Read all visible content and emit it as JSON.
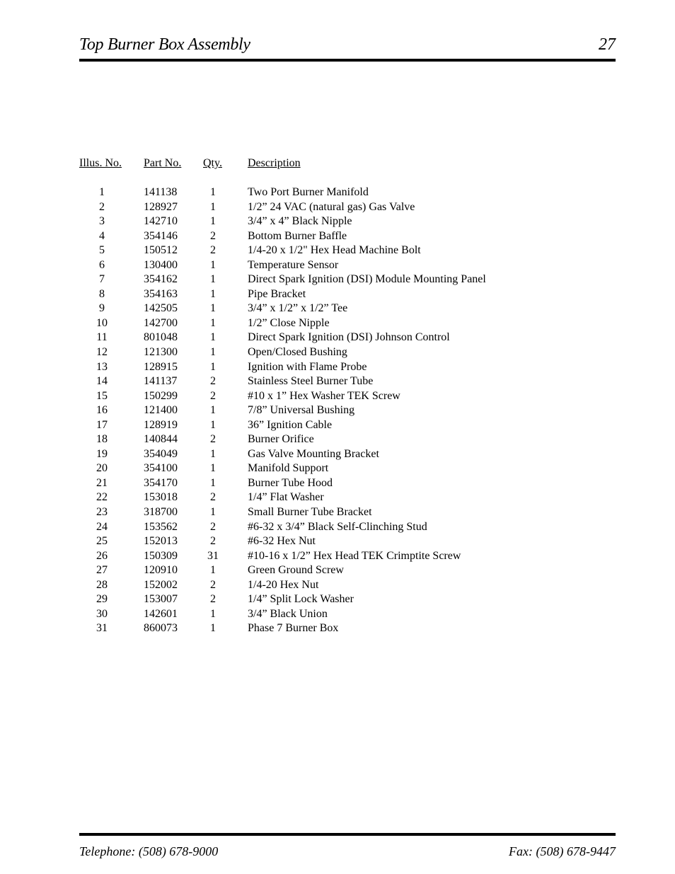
{
  "header": {
    "title": "Top Burner Box Assembly",
    "page_number": "27"
  },
  "table": {
    "columns": [
      "Illus. No.",
      "Part No.",
      "Qty.",
      "Description"
    ],
    "rows": [
      {
        "illus": "1",
        "part": "141138",
        "qty": "1",
        "desc": "Two Port Burner Manifold"
      },
      {
        "illus": "2",
        "part": "128927",
        "qty": "1",
        "desc": "1/2” 24 VAC (natural gas) Gas Valve"
      },
      {
        "illus": "3",
        "part": "142710",
        "qty": "1",
        "desc": "3/4” x 4” Black Nipple"
      },
      {
        "illus": "4",
        "part": "354146",
        "qty": "2",
        "desc": "Bottom Burner Baffle"
      },
      {
        "illus": "5",
        "part": "150512",
        "qty": "2",
        "desc": "1/4-20 x 1/2\" Hex Head Machine Bolt"
      },
      {
        "illus": "6",
        "part": "130400",
        "qty": "1",
        "desc": "Temperature  Sensor"
      },
      {
        "illus": "7",
        "part": "354162",
        "qty": "1",
        "desc": "Direct Spark Ignition (DSI) Module Mounting Panel"
      },
      {
        "illus": "8",
        "part": "354163",
        "qty": "1",
        "desc": "Pipe  Bracket"
      },
      {
        "illus": "9",
        "part": "142505",
        "qty": "1",
        "desc": "3/4” x 1/2” x 1/2” Tee"
      },
      {
        "illus": "10",
        "part": "142700",
        "qty": "1",
        "desc": "1/2” Close Nipple"
      },
      {
        "illus": "11",
        "part": "801048",
        "qty": "1",
        "desc": "Direct Spark Ignition (DSI) Johnson Control"
      },
      {
        "illus": "12",
        "part": "121300",
        "qty": "1",
        "desc": "Open/Closed Bushing"
      },
      {
        "illus": "13",
        "part": "128915",
        "qty": "1",
        "desc": "Ignition with Flame Probe"
      },
      {
        "illus": "14",
        "part": "141137",
        "qty": "2",
        "desc": "Stainless Steel Burner Tube"
      },
      {
        "illus": "15",
        "part": "150299",
        "qty": "2",
        "desc": "#10 x 1” Hex Washer TEK Screw"
      },
      {
        "illus": "16",
        "part": "121400",
        "qty": "1",
        "desc": "7/8” Universal Bushing"
      },
      {
        "illus": "17",
        "part": "128919",
        "qty": "1",
        "desc": "36” Ignition Cable"
      },
      {
        "illus": "18",
        "part": "140844",
        "qty": "2",
        "desc": "Burner Orifice"
      },
      {
        "illus": "19",
        "part": "354049",
        "qty": "1",
        "desc": "Gas Valve Mounting Bracket"
      },
      {
        "illus": "20",
        "part": "354100",
        "qty": "1",
        "desc": "Manifold Support"
      },
      {
        "illus": "21",
        "part": "354170",
        "qty": "1",
        "desc": "Burner Tube Hood"
      },
      {
        "illus": "22",
        "part": "153018",
        "qty": "2",
        "desc": "1/4” Flat Washer"
      },
      {
        "illus": "23",
        "part": "318700",
        "qty": "1",
        "desc": "Small Burner Tube Bracket"
      },
      {
        "illus": "24",
        "part": "153562",
        "qty": "2",
        "desc": "#6-32 x 3/4” Black Self-Clinching Stud"
      },
      {
        "illus": "25",
        "part": "152013",
        "qty": "2",
        "desc": "#6-32 Hex Nut"
      },
      {
        "illus": "26",
        "part": "150309",
        "qty": "31",
        "desc": "#10-16 x 1/2” Hex Head TEK Crimptite Screw"
      },
      {
        "illus": "27",
        "part": "120910",
        "qty": "1",
        "desc": "Green Ground Screw"
      },
      {
        "illus": "28",
        "part": "152002",
        "qty": "2",
        "desc": "1/4-20 Hex Nut"
      },
      {
        "illus": "29",
        "part": "153007",
        "qty": "2",
        "desc": "1/4” Split Lock Washer"
      },
      {
        "illus": "30",
        "part": "142601",
        "qty": "1",
        "desc": "3/4” Black Union"
      },
      {
        "illus": "31",
        "part": "860073",
        "qty": "1",
        "desc": "Phase 7 Burner Box"
      }
    ]
  },
  "footer": {
    "telephone": "Telephone: (508) 678-9000",
    "fax": "Fax: (508) 678-9447"
  }
}
